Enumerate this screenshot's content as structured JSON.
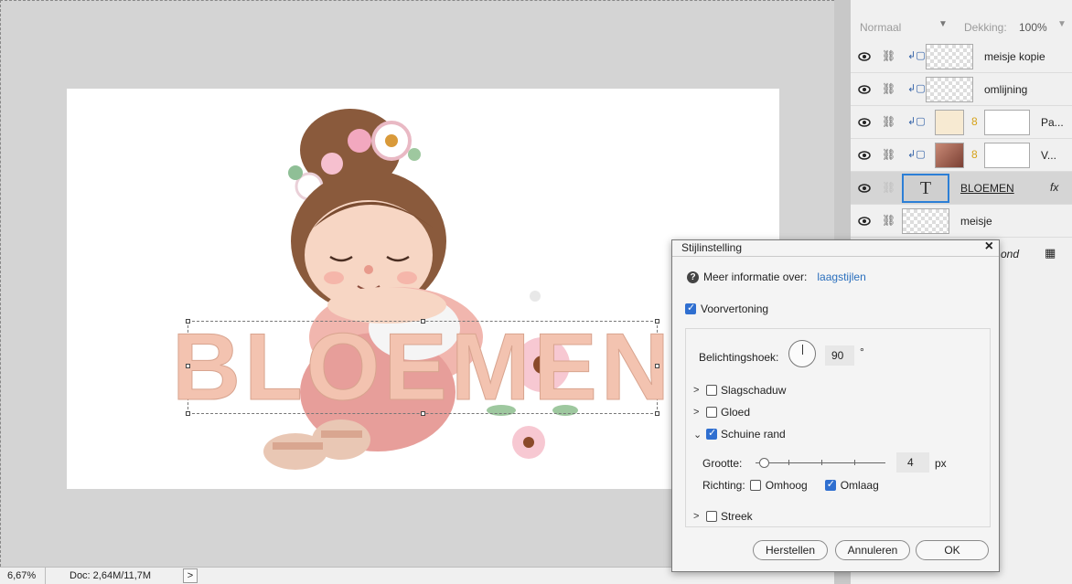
{
  "status": {
    "zoom": "6,67%",
    "doc": "Doc: 2,64M/11,7M",
    "arrow": ">"
  },
  "canvas": {
    "text": "BLOEMEN"
  },
  "layers_panel": {
    "blend_mode": "Normaal",
    "opacity_label": "Dekking:",
    "opacity_value": "100%",
    "layers": [
      {
        "name": "meisje kopie"
      },
      {
        "name": "omlijning"
      },
      {
        "name": "Pa..."
      },
      {
        "name": "V..."
      },
      {
        "name": "BLOEMEN",
        "fx": "fx",
        "thumb_char": "T"
      },
      {
        "name": "meisje"
      },
      {
        "name": "ond"
      }
    ]
  },
  "dialog": {
    "title": "Stijlinstelling",
    "close": "×",
    "info_label": "Meer informatie over:",
    "info_link": "laagstijlen",
    "preview_label": "Voorvertoning",
    "preview_checked": true,
    "angle_label": "Belichtingshoek:",
    "angle_value": "90",
    "angle_unit": "°",
    "sections": [
      {
        "label": "Slagschaduw",
        "checked": false,
        "expanded": false
      },
      {
        "label": "Gloed",
        "checked": false,
        "expanded": false
      },
      {
        "label": "Schuine rand",
        "checked": true,
        "expanded": true
      },
      {
        "label": "Streek",
        "checked": false,
        "expanded": false
      }
    ],
    "size_label": "Grootte:",
    "size_value": "4",
    "size_unit": "px",
    "direction_label": "Richting:",
    "dir_up": "Omhoog",
    "dir_up_checked": false,
    "dir_down": "Omlaag",
    "dir_down_checked": true,
    "btn_reset": "Herstellen",
    "btn_cancel": "Annuleren",
    "btn_ok": "OK"
  },
  "colors": {
    "accent": "#2f6fd0",
    "link": "#2a6fbd",
    "text_fill": "#f3c3b0"
  }
}
